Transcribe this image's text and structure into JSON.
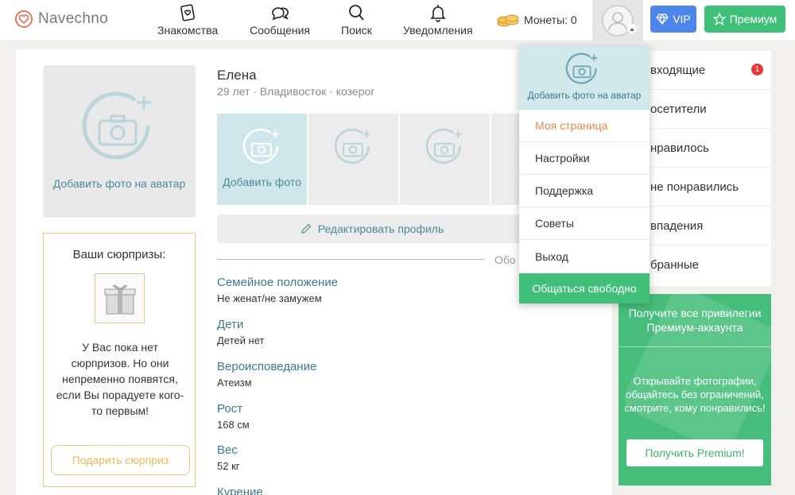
{
  "header": {
    "logo_text": "Navechno",
    "nav": [
      {
        "label": "Знакомства",
        "icon": "cards-heart-icon"
      },
      {
        "label": "Сообщения",
        "icon": "chat-bubbles-icon"
      },
      {
        "label": "Поиск",
        "icon": "search-icon"
      },
      {
        "label": "Уведомления",
        "icon": "bell-icon"
      }
    ],
    "coins_label": "Монеты: 0",
    "vip_label": "VIP",
    "premium_label": "Премиум"
  },
  "avatar_box": {
    "label": "Добавить фото на аватар"
  },
  "surprises": {
    "title": "Ваши сюрпризы:",
    "text": "У Вас пока нет сюрпризов. Но они непременно появятся, если Вы порадуете кого-то первым!",
    "button": "Подарить сюрприз"
  },
  "profile": {
    "name": "Елена",
    "meta": "29 лет · Владивосток · козерог",
    "add_photo_label": "Добавить фото",
    "edit_label": "Редактировать профиль",
    "divider_label": "Обо",
    "fields": [
      {
        "label": "Семейное положение",
        "value": "Не женат/не замужем"
      },
      {
        "label": "Дети",
        "value": "Детей нет"
      },
      {
        "label": "Вероисповедание",
        "value": "Атеизм"
      },
      {
        "label": "Рост",
        "value": "168 см"
      },
      {
        "label": "Вес",
        "value": "52 кг"
      },
      {
        "label": "Курение",
        "value": ""
      }
    ]
  },
  "right_menu": {
    "items": [
      "Входящие",
      "Посетители",
      "Понравилось",
      "Не понравились",
      "Совпадения",
      "Избранные"
    ],
    "visible_items": [
      "входящие",
      "осетители",
      "нравилось",
      "не понравились",
      "впадения",
      "бранные"
    ],
    "badge": "1"
  },
  "promo": {
    "title": "Получите все привилегии Премиум-аккаунта",
    "text": "Открывайте фотографии, общайтесь без ограничений, смотрите, кому понравились!",
    "button": "Получить Premium!"
  },
  "dropdown": {
    "head_label": "Добавить фото на аватар",
    "items": [
      "Моя страница",
      "Настройки",
      "Поддержка",
      "Советы",
      "Выход"
    ],
    "cta": "Общаться свободно"
  },
  "colors": {
    "accent_green": "#3fbf77",
    "vip_blue": "#4b86e8",
    "teal_text": "#3a7a8c",
    "orange": "#e08a55"
  }
}
